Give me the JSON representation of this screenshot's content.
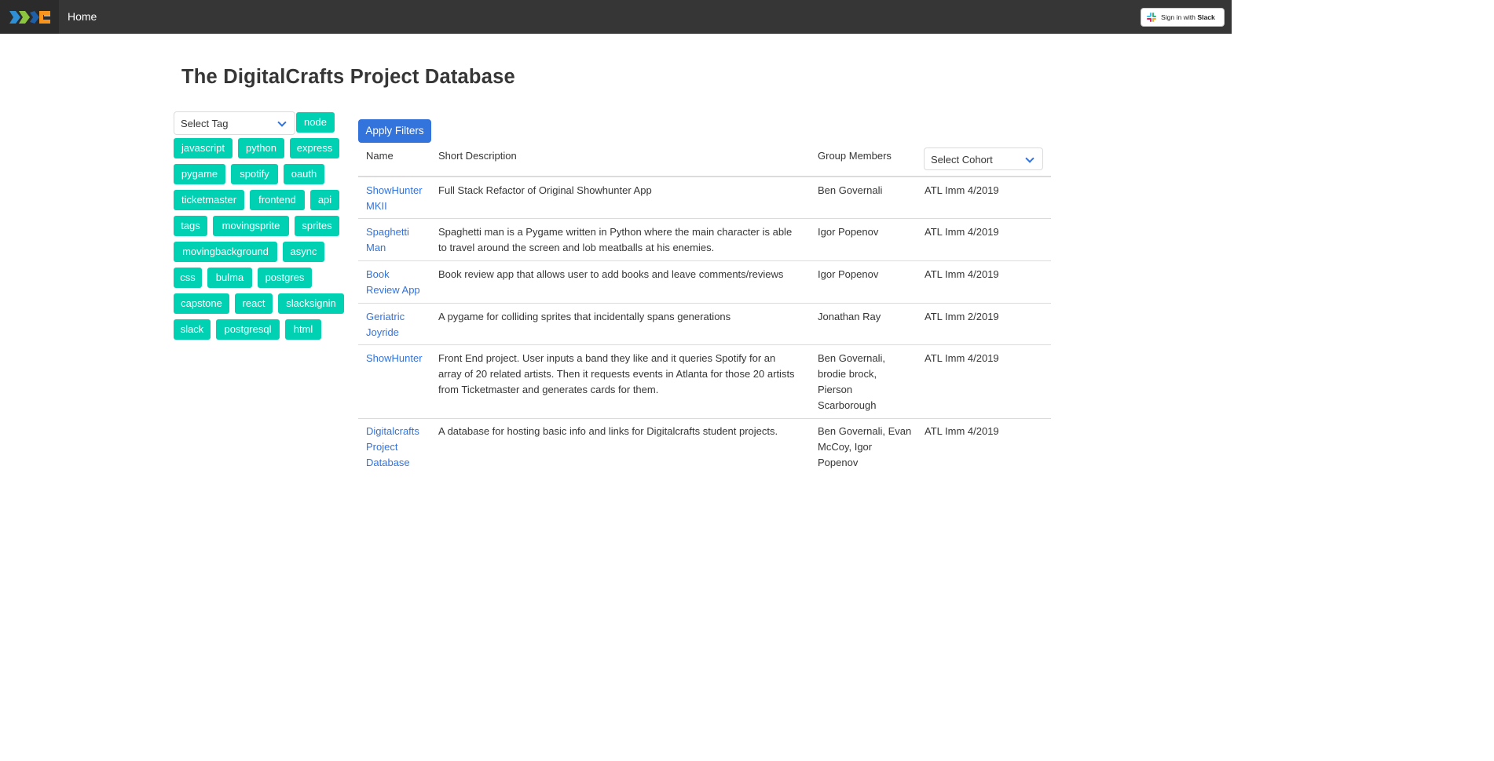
{
  "navbar": {
    "home_label": "Home",
    "slack_prefix": "Sign in with ",
    "slack_brand": "Slack"
  },
  "page_title": "The DigitalCrafts Project Database",
  "filters": {
    "select_tag_label": "Select Tag",
    "apply_label": "Apply Filters",
    "select_cohort_label": "Select Cohort"
  },
  "tags": [
    "node",
    "javascript",
    "python",
    "express",
    "pygame",
    "spotify",
    "oauth",
    "ticketmaster",
    "frontend",
    "api",
    "tags",
    "movingsprite",
    "sprites",
    "movingbackground",
    "async",
    "css",
    "bulma",
    "postgres",
    "capstone",
    "react",
    "slacksignin",
    "slack",
    "postgresql",
    "html"
  ],
  "table": {
    "headers": {
      "name": "Name",
      "description": "Short Description",
      "members": "Group Members"
    },
    "rows": [
      {
        "name": [
          "ShowHunter",
          "MKII"
        ],
        "description": [
          "Full Stack Refactor of Original Showhunter App"
        ],
        "members": [
          "Ben Governali"
        ],
        "cohort": "ATL Imm 4/2019"
      },
      {
        "name": [
          "Spaghetti",
          "Man"
        ],
        "description": [
          "Spaghetti man is a Pygame written in Python where the main character is able",
          "to travel around the screen and lob meatballs at his enemies."
        ],
        "members": [
          "Igor Popenov"
        ],
        "cohort": "ATL Imm 4/2019"
      },
      {
        "name": [
          "Book",
          "Review App"
        ],
        "description": [
          "Book review app that allows user to add books and leave comments/reviews"
        ],
        "members": [
          "Igor Popenov"
        ],
        "cohort": "ATL Imm 4/2019"
      },
      {
        "name": [
          "Geriatric",
          "Joyride"
        ],
        "description": [
          "A pygame for colliding sprites that incidentally spans generations"
        ],
        "members": [
          "Jonathan Ray"
        ],
        "cohort": "ATL Imm 2/2019"
      },
      {
        "name": [
          "ShowHunter"
        ],
        "description": [
          "Front End project. User inputs a band they like and it queries Spotify for an",
          "array of 20 related artists. Then it requests events in Atlanta for those 20 artists",
          "from Ticketmaster and generates cards for them."
        ],
        "members": [
          "Ben Governali,",
          "brodie brock,",
          "Pierson",
          "Scarborough"
        ],
        "cohort": "ATL Imm 4/2019"
      },
      {
        "name": [
          "Digitalcrafts",
          "Project",
          "Database"
        ],
        "description": [
          "A database for hosting basic info and links for Digitalcrafts student projects."
        ],
        "members": [
          "Ben Governali, Evan",
          "McCoy, Igor",
          "Popenov"
        ],
        "cohort": "ATL Imm 4/2019"
      }
    ]
  },
  "colors": {
    "navbar": "#363636",
    "tag": "#00d1b2",
    "link": "#3273dc",
    "primary_button": "#3273dc"
  }
}
